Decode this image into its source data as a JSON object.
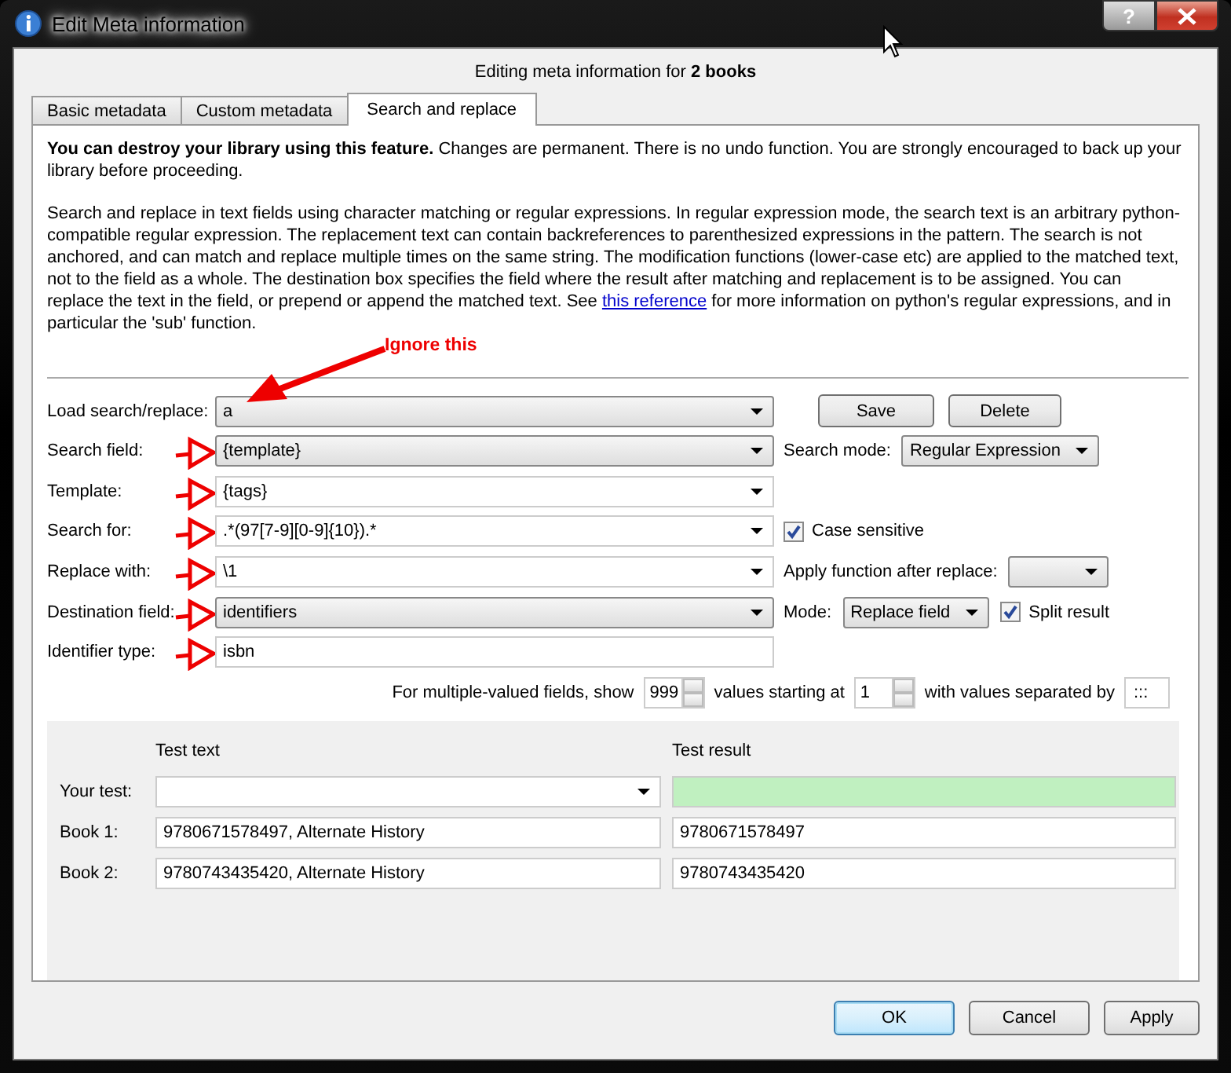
{
  "window": {
    "title": "Edit Meta information",
    "help": "?"
  },
  "header": "Editing meta information for **2 books**",
  "tabs": [
    {
      "label": "Basic metadata",
      "selected": false
    },
    {
      "label": "Custom metadata",
      "selected": false
    },
    {
      "label": "Search and replace",
      "selected": true
    }
  ],
  "warning": "**You can destroy your library using this feature.** Changes are permanent. There is no undo function. You are strongly encouraged to back up your library before proceeding.",
  "description": {
    "before": "Search and replace in text fields using character matching or regular expressions. In regular expression mode, the search text is an arbitrary python-compatible regular expression. The replacement text can contain backreferences to parenthesized expressions in the pattern. The search is not anchored, and can match and replace multiple times on the same string. The modification functions (lower-case etc) are applied to the matched text, not to the field as a whole. The destination box specifies the field where the result after matching and replacement is to be assigned. You can replace the text in the field, or prepend or append the matched text. See ",
    "link": "this reference",
    "after": " for more information on python's regular expressions, and in particular the 'sub' function."
  },
  "annotation": "Ignore this",
  "load": {
    "label": "Load search/replace:",
    "value": "a",
    "arrow": true,
    "buttons": [
      "Save",
      "Delete"
    ]
  },
  "rows": [
    {
      "label": "Search field:",
      "kind": "combo",
      "value": "{template}",
      "arrow": true,
      "right": [
        {
          "kind": "label",
          "text": "Search mode:"
        },
        {
          "kind": "combo",
          "text": "Regular Expression"
        }
      ]
    },
    {
      "label": "Template:",
      "kind": "editable",
      "value": "{tags}",
      "arrow": true,
      "right": []
    },
    {
      "label": "Search for:",
      "kind": "editable",
      "value": ".*(97[7-9][0-9]{10}).*",
      "arrow": true,
      "right": [
        {
          "kind": "checkbox",
          "text": "Case sensitive",
          "checked": true
        }
      ]
    },
    {
      "label": "Replace with:",
      "kind": "editable",
      "value": "\\1",
      "arrow": true,
      "right": [
        {
          "kind": "label",
          "text": "Apply function after replace:"
        },
        {
          "kind": "combo"
        }
      ]
    },
    {
      "label": "Destination field:",
      "kind": "combo",
      "value": "identifiers",
      "arrow": true,
      "right": [
        {
          "kind": "label",
          "text": "Mode:"
        },
        {
          "kind": "combo",
          "text": "Replace field"
        },
        {
          "kind": "checkbox",
          "text": "Split result",
          "checked": true
        }
      ]
    },
    {
      "label": "Identifier type:",
      "kind": "input",
      "value": "isbn",
      "arrow": true,
      "right": []
    }
  ],
  "multi": [
    {
      "kind": "label",
      "text": "For multiple-valued fields, show"
    },
    {
      "kind": "spin",
      "text": "999"
    },
    {
      "kind": "label",
      "text": "values starting at"
    },
    {
      "kind": "spin",
      "text": "1"
    },
    {
      "kind": "label",
      "text": "with values separated by"
    },
    {
      "kind": "input",
      "text": ":::"
    }
  ],
  "test": {
    "headers": [
      "Test text",
      "Test result"
    ],
    "rows": [
      {
        "label": "Your test:",
        "kind": "test"
      },
      {
        "label": "Book 1:",
        "kind": "book",
        "text": "9780671578497, Alternate History",
        "result": "9780671578497"
      },
      {
        "label": "Book 2:",
        "kind": "book",
        "text": "9780743435420, Alternate History",
        "result": "9780743435420"
      }
    ]
  },
  "buttons": [
    {
      "label": "OK",
      "default": true
    },
    {
      "label": "Cancel",
      "default": false
    },
    {
      "label": "Apply",
      "default": false
    }
  ]
}
